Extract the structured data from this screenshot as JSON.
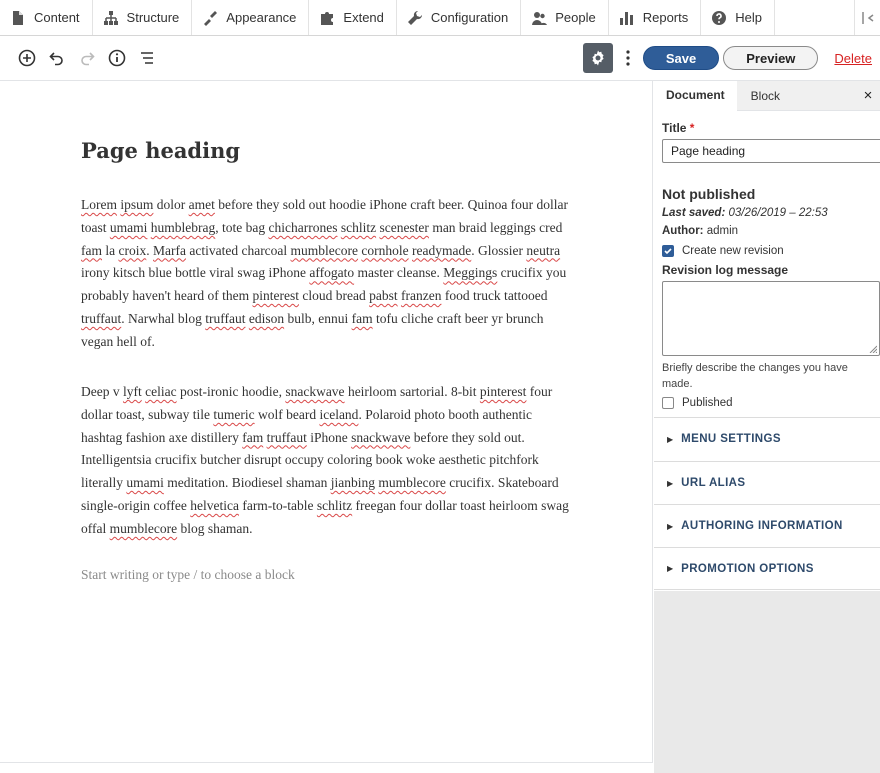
{
  "admin_toolbar": {
    "items": [
      {
        "label": "Content",
        "icon": "file-icon"
      },
      {
        "label": "Structure",
        "icon": "structure-icon"
      },
      {
        "label": "Appearance",
        "icon": "paintbrush-icon"
      },
      {
        "label": "Extend",
        "icon": "puzzle-icon"
      },
      {
        "label": "Configuration",
        "icon": "wrench-icon"
      },
      {
        "label": "People",
        "icon": "people-icon"
      },
      {
        "label": "Reports",
        "icon": "bar-chart-icon"
      },
      {
        "label": "Help",
        "icon": "help-icon"
      }
    ]
  },
  "editor_header": {
    "save_label": "Save",
    "preview_label": "Preview",
    "delete_label": "Delete"
  },
  "content": {
    "heading": "Page heading",
    "placeholder": "Start writing or type / to choose a block"
  },
  "sidebar": {
    "tabs": {
      "document": "Document",
      "block": "Block"
    },
    "close_symbol": "×",
    "title_label": "Title",
    "required_mark": "*",
    "title_value": "Page heading",
    "status": "Not published",
    "last_saved_label": "Last saved:",
    "last_saved_value": "03/26/2019 – 22:53",
    "author_label": "Author:",
    "author_value": "admin",
    "create_revision_label": "Create new revision",
    "create_revision_checked": true,
    "revision_log_label": "Revision log message",
    "revision_desc": "Briefly describe the changes you have made.",
    "published_label": "Published",
    "published_checked": false,
    "panels": [
      "MENU SETTINGS",
      "URL ALIAS",
      "AUTHORING INFORMATION",
      "PROMOTION OPTIONS"
    ]
  },
  "colors": {
    "primary": "#2f5d98",
    "delete": "#d72222",
    "settings_bg": "#555d66"
  }
}
